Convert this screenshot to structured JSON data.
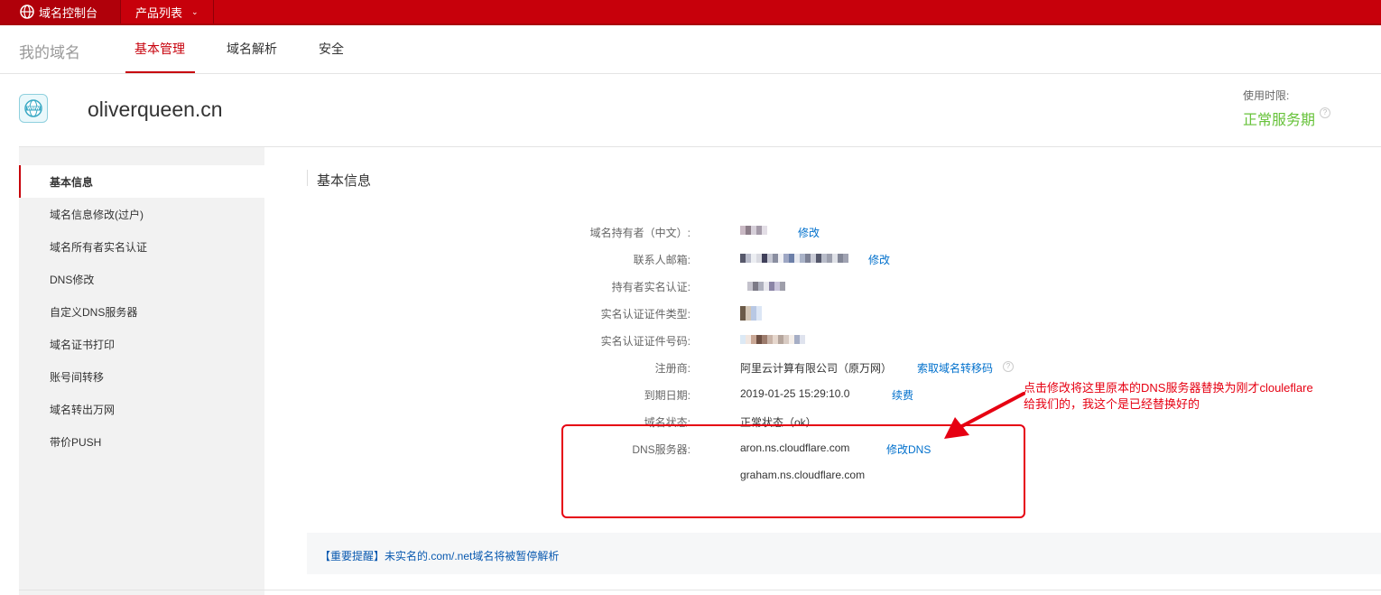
{
  "topbar": {
    "console_label": "域名控制台",
    "product_menu_label": "产品列表"
  },
  "nav": {
    "title": "我的域名",
    "tabs": [
      {
        "label": "基本管理",
        "active": true
      },
      {
        "label": "域名解析",
        "active": false
      },
      {
        "label": "安全",
        "active": false
      }
    ]
  },
  "domain": {
    "name": "oliverqueen.cn",
    "icon": "www-globe-icon",
    "use_period_label": "使用时限:",
    "use_period_status": "正常服务期"
  },
  "sidebar": {
    "items": [
      {
        "label": "基本信息",
        "active": true
      },
      {
        "label": "域名信息修改(过户)"
      },
      {
        "label": "域名所有者实名认证"
      },
      {
        "label": "DNS修改"
      },
      {
        "label": "自定义DNS服务器"
      },
      {
        "label": "域名证书打印"
      },
      {
        "label": "账号间转移"
      },
      {
        "label": "域名转出万网"
      },
      {
        "label": "带价PUSH"
      }
    ]
  },
  "content": {
    "section_title": "基本信息",
    "rows": {
      "holder": {
        "label": "域名持有者（中文）:",
        "link": "修改"
      },
      "email": {
        "label": "联系人邮箱:",
        "link": "修改"
      },
      "realname": {
        "label": "持有者实名认证:"
      },
      "cert_type": {
        "label": "实名认证证件类型:"
      },
      "cert_no": {
        "label": "实名认证证件号码:"
      },
      "registrar": {
        "label": "注册商:",
        "value": "阿里云计算有限公司（原万网）",
        "link": "索取域名转移码"
      },
      "expiry": {
        "label": "到期日期:",
        "value": "2019-01-25 15:29:10.0",
        "link": "续费"
      },
      "status": {
        "label": "域名状态:",
        "value": "正常状态（ok）"
      },
      "dns": {
        "label": "DNS服务器:",
        "value1": "aron.ns.cloudflare.com",
        "value2": "graham.ns.cloudflare.com",
        "link": "修改DNS"
      }
    }
  },
  "annotation": {
    "line1": "点击修改将这里原本的DNS服务器替换为刚才clouleflare",
    "line2": "给我们的，我这个是已经替换好的"
  },
  "notice": {
    "text": "【重要提醒】未实名的.com/.net域名将被暂停解析"
  },
  "colors": {
    "brand_red": "#c7000b",
    "link_blue": "#0070cc",
    "status_green": "#67c23a",
    "annotation_red": "#e60012"
  }
}
